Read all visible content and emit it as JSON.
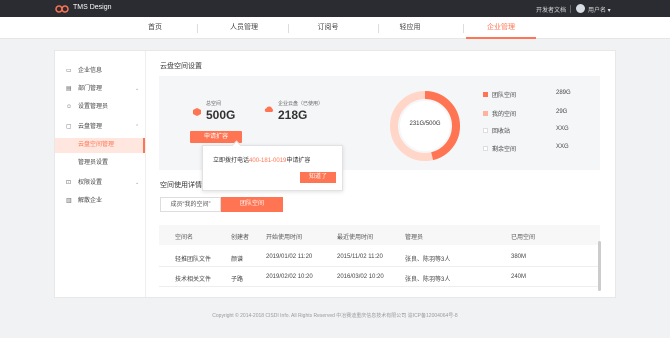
{
  "topbar": {
    "brand": "TMS Design",
    "dev_doc": "开发者文档",
    "username": "用户名 ▾"
  },
  "nav": {
    "items": [
      {
        "label": "首页"
      },
      {
        "label": "人员管理"
      },
      {
        "label": "订阅号"
      },
      {
        "label": "轻应用"
      },
      {
        "label": "企业管理"
      }
    ],
    "active_index": 4
  },
  "sidebar": {
    "items": [
      {
        "icon": "monitor-icon",
        "label": "企业信息",
        "chevron": ""
      },
      {
        "icon": "building-icon",
        "label": "部门管理",
        "chevron": "⌄"
      },
      {
        "icon": "user-icon",
        "label": "设置管理员",
        "chevron": ""
      },
      {
        "icon": "cloud-icon",
        "label": "云盘管理",
        "chevron": "⌃"
      },
      {
        "icon": "",
        "label": "云盘空间管理",
        "chevron": ""
      },
      {
        "icon": "",
        "label": "管理员设置",
        "chevron": ""
      },
      {
        "icon": "lock-icon",
        "label": "权限设置",
        "chevron": "⌄"
      },
      {
        "icon": "trash-icon",
        "label": "解散企业",
        "chevron": ""
      }
    ]
  },
  "storage": {
    "title": "云盘空间设置",
    "total_label": "总空间",
    "total_value": "500G",
    "used_label": "企业云盘（已使用）",
    "used_value": "218G",
    "apply_button": "申请扩容",
    "ring_text": "231G/500G",
    "ring_used_fraction": 0.462,
    "legend": [
      {
        "name": "团队空间",
        "value": "289G",
        "color": "#ff7452"
      },
      {
        "name": "我的空间",
        "value": "29G",
        "color": "#ffb39c"
      },
      {
        "name": "回收站",
        "value": "XXG",
        "color": "#ffffff"
      },
      {
        "name": "剩余空间",
        "value": "XXG",
        "color": "#ffffff"
      }
    ]
  },
  "popover": {
    "text_before": "立即拨打电话",
    "phone": "400-181-0019",
    "text_after": "申请扩容",
    "button": "知道了"
  },
  "usage": {
    "title": "空间使用详情",
    "tabs": [
      "成员“我的空间”",
      "团队空间"
    ],
    "columns": [
      "空间名",
      "创建者",
      "开始使用时间",
      "最近使用时间",
      "管理员",
      "已用空间"
    ],
    "rows": [
      [
        "轻推团队文件",
        "颜谱",
        "2019/01/02  11:20",
        "2015/11/02  11:20",
        "张良、陈羽等3人",
        "380M"
      ],
      [
        "技术相关文件",
        "子路",
        "2019/02/02  10:20",
        "2016/03/02  10:20",
        "张良、陈羽等3人",
        "240M"
      ]
    ]
  },
  "footer": "Copyright © 2014-2018 CISDI Info. All Rights Reserved  中冶赛迪重庆信息技术有限公司 渝ICP备12004064号-8"
}
